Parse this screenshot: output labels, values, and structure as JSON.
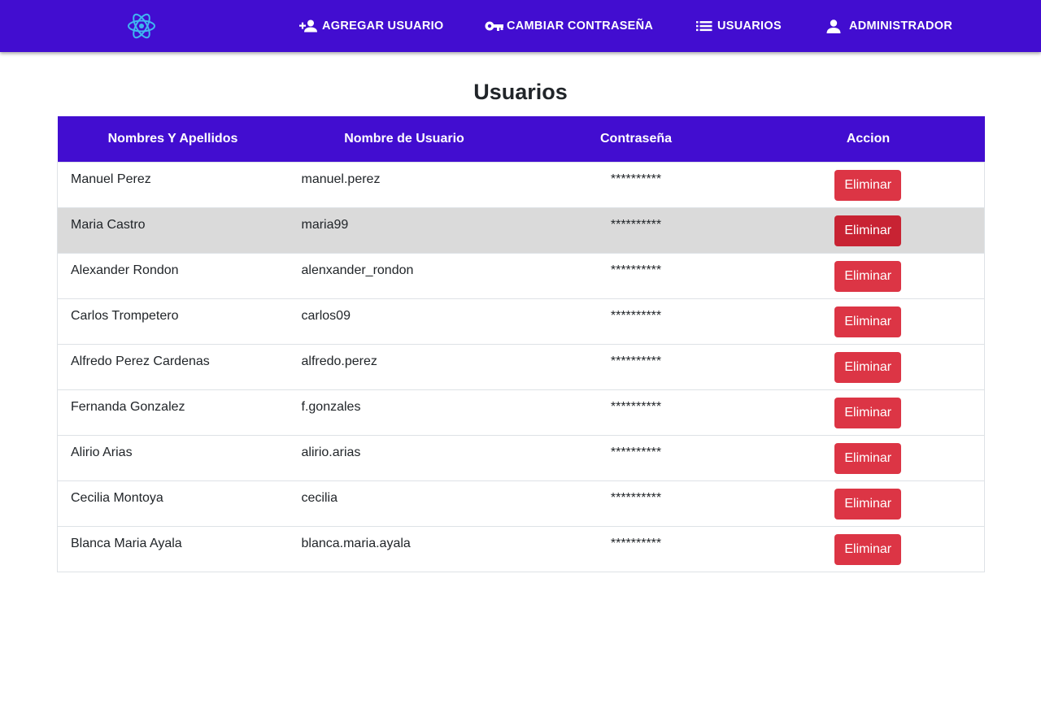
{
  "colors": {
    "primary": "#420dd0",
    "danger": "#dc3545",
    "danger_hover": "#c82333",
    "row_hover": "#dadada"
  },
  "navbar": {
    "logo_icon": "atom-logo-icon",
    "items": [
      {
        "icon": "person-add-icon",
        "label": "AGREGAR USUARIO"
      },
      {
        "icon": "key-icon",
        "label": "CAMBIAR CONTRASEÑA"
      },
      {
        "icon": "list-icon",
        "label": "USUARIOS"
      },
      {
        "icon": "person-icon",
        "label": "ADMINISTRADOR"
      }
    ]
  },
  "page": {
    "title": "Usuarios"
  },
  "table": {
    "headers": [
      "Nombres Y Apellidos",
      "Nombre de Usuario",
      "Contraseña",
      "Accion"
    ],
    "rows": [
      {
        "name": "Manuel Perez",
        "username": "manuel.perez",
        "password": "**********",
        "action": "Eliminar"
      },
      {
        "name": "Maria Castro",
        "username": "maria99",
        "password": "**********",
        "action": "Eliminar"
      },
      {
        "name": "Alexander Rondon",
        "username": "alenxander_rondon",
        "password": "**********",
        "action": "Eliminar"
      },
      {
        "name": "Carlos Trompetero",
        "username": "carlos09",
        "password": "**********",
        "action": "Eliminar"
      },
      {
        "name": "Alfredo Perez Cardenas",
        "username": "alfredo.perez",
        "password": "**********",
        "action": "Eliminar"
      },
      {
        "name": "Fernanda Gonzalez",
        "username": "f.gonzales",
        "password": "**********",
        "action": "Eliminar"
      },
      {
        "name": "Alirio Arias",
        "username": "alirio.arias",
        "password": "**********",
        "action": "Eliminar"
      },
      {
        "name": "Cecilia Montoya",
        "username": "cecilia",
        "password": "**********",
        "action": "Eliminar"
      },
      {
        "name": "Blanca Maria Ayala",
        "username": "blanca.maria.ayala",
        "password": "**********",
        "action": "Eliminar"
      }
    ]
  }
}
